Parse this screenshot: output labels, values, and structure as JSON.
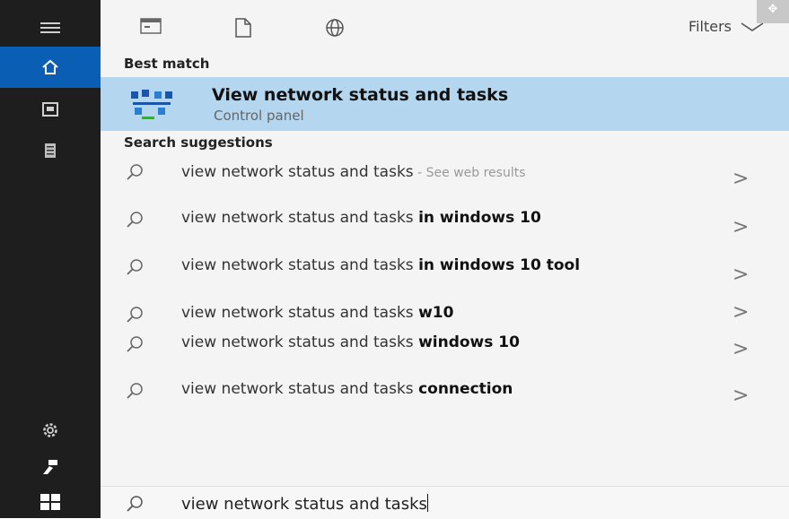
{
  "sidebar": {
    "items": [
      {
        "icon": "hamburger-menu-icon"
      },
      {
        "icon": "home-icon",
        "active": true
      },
      {
        "icon": "camera-icon"
      },
      {
        "icon": "document-icon"
      },
      {
        "icon": "gear-icon"
      },
      {
        "icon": "user-icon"
      },
      {
        "icon": "windows-start-icon"
      }
    ]
  },
  "toolbar": {
    "icons": [
      "apps-icon",
      "documents-icon",
      "web-icon"
    ],
    "filters_label": "Filters"
  },
  "best_match": {
    "heading": "Best match",
    "title": "View network status and tasks",
    "subtitle": "Control panel",
    "icon": "network-icon"
  },
  "suggestions": {
    "heading": "Search suggestions",
    "items": [
      {
        "normal": "view network status and tasks",
        "bold": "",
        "extra": " - See web results"
      },
      {
        "normal": "view network status and tasks ",
        "bold": "in windows 10",
        "extra": ""
      },
      {
        "normal": "view network status and tasks ",
        "bold": "in windows 10 tool",
        "extra": ""
      },
      {
        "normal": "view network status and tasks ",
        "bold": "w10",
        "extra": ""
      },
      {
        "normal": "view network status and tasks ",
        "bold": "windows 10",
        "extra": ""
      },
      {
        "normal": "view network status and tasks ",
        "bold": "connection",
        "extra": ""
      }
    ],
    "chevron": ">"
  },
  "search": {
    "query": "view network status and tasks"
  },
  "colors": {
    "sidebar_bg": "#1e1e1e",
    "active_accent": "#0a5fb4",
    "best_match_bg": "#b4d6ef"
  }
}
